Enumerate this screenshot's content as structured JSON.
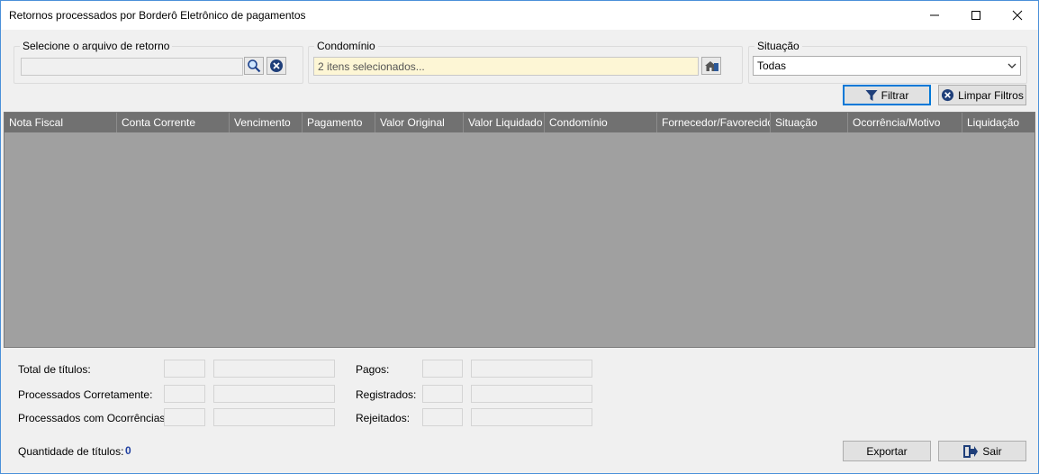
{
  "window": {
    "title": "Retornos processados por Borderô Eletrônico de pagamentos"
  },
  "filters": {
    "arquivo": {
      "legend": "Selecione o arquivo de retorno",
      "value": ""
    },
    "condominio": {
      "legend": "Condomínio",
      "value": "2 itens selecionados..."
    },
    "situacao": {
      "legend": "Situação",
      "value": "Todas"
    }
  },
  "buttons": {
    "filtrar": "Filtrar",
    "limpar": "Limpar Filtros",
    "exportar": "Exportar",
    "sair": "Sair"
  },
  "grid": {
    "columns": [
      "Nota Fiscal",
      "Conta Corrente",
      "Vencimento",
      "Pagamento",
      "Valor Original",
      "Valor Liquidado",
      "Condomínio",
      "Fornecedor/Favorecido",
      "Situação",
      "Ocorrência/Motivo",
      "Liquidação"
    ]
  },
  "summary": {
    "total_titulos": "Total de títulos:",
    "processados_corretamente": "Processados Corretamente:",
    "processados_ocorrencias": "Processados com Ocorrências:",
    "pagos": "Pagos:",
    "registrados": "Registrados:",
    "rejeitados": "Rejeitados:",
    "quantidade_label": "Quantidade de títulos:",
    "quantidade_value": "0"
  },
  "colors": {
    "accent": "#0078d7",
    "grid_bg": "#a0a0a0",
    "grid_header": "#717171",
    "count": "#1f3fa0"
  },
  "icons": [
    "minimize-icon",
    "maximize-icon",
    "close-icon",
    "search-icon",
    "clear-icon",
    "building-icon",
    "filter-icon",
    "chevron-down-icon",
    "exit-icon"
  ]
}
